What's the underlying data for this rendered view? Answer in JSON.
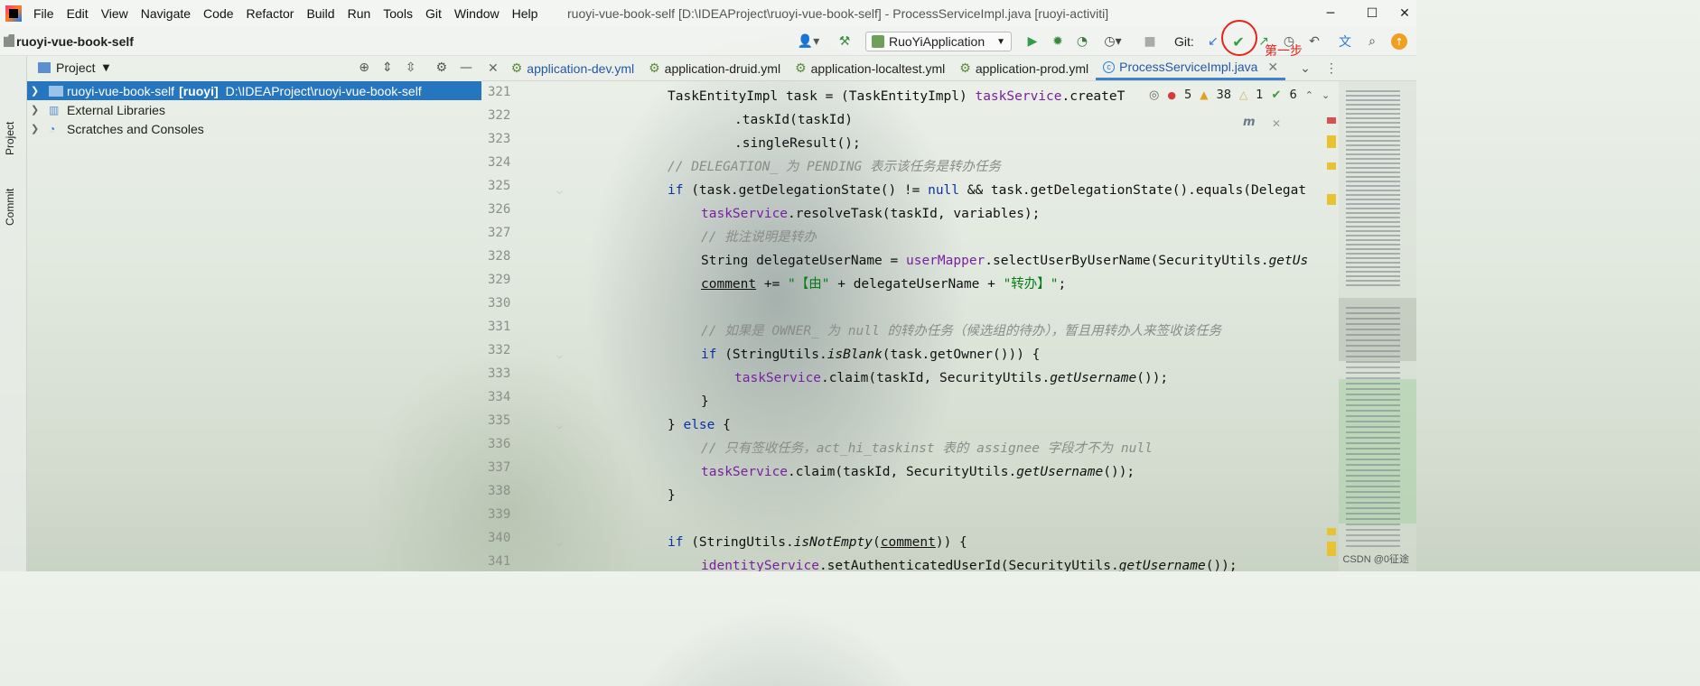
{
  "menu": [
    "File",
    "Edit",
    "View",
    "Navigate",
    "Code",
    "Refactor",
    "Build",
    "Run",
    "Tools",
    "Git",
    "Window",
    "Help"
  ],
  "window_title": "ruoyi-vue-book-self [D:\\IDEAProject\\ruoyi-vue-book-self] - ProcessServiceImpl.java [ruoyi-activiti]",
  "project_name": "ruoyi-vue-book-self",
  "run_config": "RuoYiApplication",
  "git_label": "Git:",
  "annotation": "第一步",
  "side_tabs": {
    "project": "Project",
    "commit": "Commit"
  },
  "project_panel": {
    "title": "Project",
    "tree": [
      {
        "name": "ruoyi-vue-book-self",
        "module": "[ruoyi]",
        "path": "D:\\IDEAProject\\ruoyi-vue-book-self"
      },
      {
        "name": "External Libraries"
      },
      {
        "name": "Scratches and Consoles"
      }
    ]
  },
  "tabs": [
    {
      "label": "application-dev.yml"
    },
    {
      "label": "application-druid.yml"
    },
    {
      "label": "application-localtest.yml"
    },
    {
      "label": "application-prod.yml"
    },
    {
      "label": "ProcessServiceImpl.java"
    }
  ],
  "inspections": {
    "errors": "5",
    "warnings": "38",
    "weak": "1",
    "ok": "6"
  },
  "line_numbers": [
    "321",
    "322",
    "323",
    "324",
    "325",
    "326",
    "327",
    "328",
    "329",
    "330",
    "331",
    "332",
    "333",
    "334",
    "335",
    "336",
    "337",
    "338",
    "339",
    "340",
    "341"
  ],
  "code": {
    "l321": [
      "TaskEntityImpl task = (TaskEntityImpl) ",
      "taskService",
      ".createT"
    ],
    "l322": [
      ".taskId(taskId)"
    ],
    "l323": [
      ".singleResult();"
    ],
    "l324": [
      "// DELEGATION_ 为 PENDING 表示该任务是转办任务"
    ],
    "l325": [
      "if",
      " (task.getDelegationState() != ",
      "null",
      " && task.getDelegationState().equals(Delegat"
    ],
    "l326": [
      "taskService",
      ".resolveTask(taskId, variables);"
    ],
    "l327": [
      "// 批注说明是转办"
    ],
    "l328": [
      "String delegateUserName = ",
      "userMapper",
      ".selectUserByUserName(SecurityUtils.",
      "getUs"
    ],
    "l329": [
      "comment",
      " += ",
      "\"【由\"",
      " + delegateUserName + ",
      "\"转办】\"",
      ";"
    ],
    "l331": [
      "// 如果是 OWNER_ 为 null 的转办任务（候选组的待办），暂且用转办人来签收该任务"
    ],
    "l332": [
      "if",
      " (StringUtils.",
      "isBlank",
      "(task.getOwner())) {"
    ],
    "l333": [
      "taskService",
      ".claim(taskId, SecurityUtils.",
      "getUsername",
      "());"
    ],
    "l334": [
      "}"
    ],
    "l335": [
      "} ",
      "else",
      " {"
    ],
    "l336": [
      "// 只有签收任务，act_hi_taskinst 表的 assignee 字段才不为 null"
    ],
    "l337": [
      "taskService",
      ".claim(taskId, SecurityUtils.",
      "getUsername",
      "());"
    ],
    "l338": [
      "}"
    ],
    "l340": [
      "if",
      " (StringUtils.",
      "isNotEmpty",
      "(",
      "comment",
      ")) {"
    ],
    "l341": [
      "identityService",
      ".setAuthenticatedUserId(SecurityUtils.",
      "getUsername",
      "());"
    ]
  },
  "watermark": "CSDN @0征途",
  "colors": {
    "selection": "#2675bf",
    "keyword": "#0a32a6",
    "field": "#7a1fa2",
    "comment": "#8a8c88",
    "string": "#067d17",
    "annotation": "#e8231b"
  },
  "icons": [
    "app-logo-icon",
    "user-icon",
    "hammer-icon",
    "run-icon",
    "debug-icon",
    "coverage-icon",
    "profile-icon",
    "stop-icon",
    "git-update-icon",
    "git-commit-icon",
    "git-push-icon",
    "history-icon",
    "rollback-icon",
    "translate-icon",
    "search-icon",
    "plugin-icon",
    "minimize-icon",
    "maximize-icon",
    "close-icon",
    "locate-icon",
    "expand-all-icon",
    "collapse-all-icon",
    "gear-icon",
    "hide-icon",
    "module-folder-icon",
    "library-icon",
    "scratch-icon",
    "chevron-right-icon",
    "reader-mode-icon",
    "error-icon",
    "warning-icon",
    "weak-warning-icon",
    "check-icon",
    "arrow-up-icon",
    "arrow-down-icon"
  ]
}
